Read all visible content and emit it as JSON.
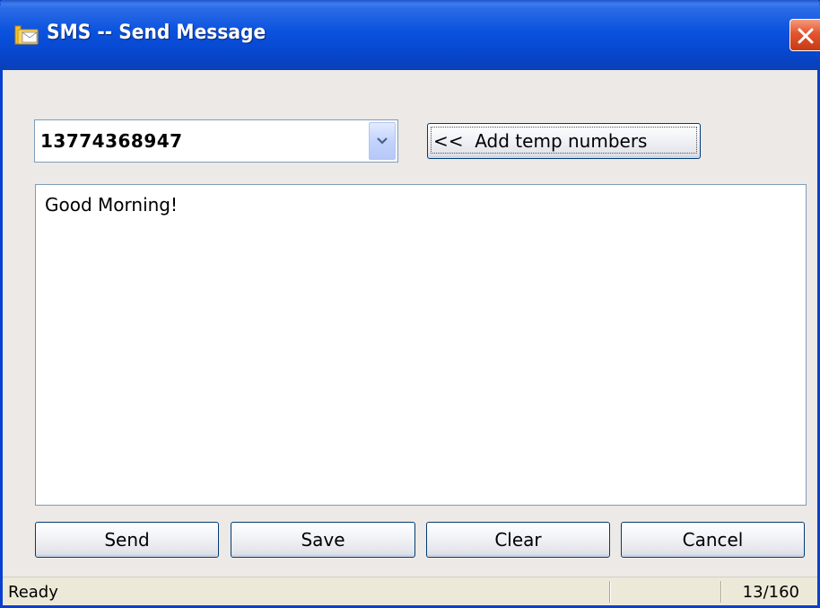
{
  "window": {
    "title": "SMS -- Send Message",
    "icon": "folder-envelope-icon",
    "close_icon": "close-icon"
  },
  "recipient": {
    "value": "13774368947",
    "dropdown_icon": "chevron-down-icon"
  },
  "add_temp_button": {
    "label": "<<  Add temp numbers"
  },
  "message": {
    "text": "Good Morning!"
  },
  "actions": {
    "send_label": "Send",
    "save_label": "Save",
    "clear_label": "Clear",
    "cancel_label": "Cancel"
  },
  "status": {
    "text": "Ready",
    "char_count": "13/160"
  },
  "colors": {
    "titlebar": "#0A52DE",
    "window_bg": "#ECE9E6",
    "close_button": "#E2552E",
    "button_border": "#003C74"
  }
}
